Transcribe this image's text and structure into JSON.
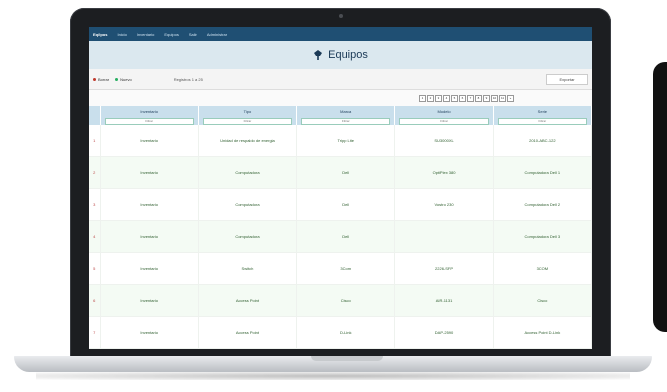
{
  "app": {
    "brand": "Eq/ipos",
    "nav": [
      "Inicio",
      "Inventario",
      "Equipos",
      "Salir",
      "Administrar"
    ]
  },
  "page": {
    "title": "Equipos"
  },
  "actions": {
    "delete_label": "Borrar",
    "new_label": "Nuevo",
    "info": "Registros 1 a 25",
    "export_label": "Exportar"
  },
  "pager": {
    "pages": [
      "1",
      "2",
      "3",
      "4",
      "5",
      "6",
      "7",
      "8",
      "9",
      "10",
      "11",
      "»"
    ]
  },
  "table": {
    "headers": [
      "Inventario",
      "Tipo",
      "Marca",
      "Modelo",
      "Serie"
    ],
    "filter_placeholder": "Filtrar",
    "rows": [
      {
        "n": "1",
        "cells": [
          "Inventario",
          "Unidad de respaldo de energia",
          "Tripp Lite",
          "SU3000XL",
          "2010-ABC-122"
        ]
      },
      {
        "n": "2",
        "cells": [
          "Inventario",
          "Computadora",
          "Dell",
          "OptiPlex 380",
          "Computadora Dell 1"
        ]
      },
      {
        "n": "3",
        "cells": [
          "Inventario",
          "Computadora",
          "Dell",
          "Vostro 230",
          "Computadora Dell 2"
        ]
      },
      {
        "n": "4",
        "cells": [
          "Inventario",
          "Computadora",
          "Dell",
          "",
          "Computadora Dell 3"
        ]
      },
      {
        "n": "5",
        "cells": [
          "Inventario",
          "Switch",
          "3Com",
          "2226-SFP",
          "3COM"
        ]
      },
      {
        "n": "6",
        "cells": [
          "Inventario",
          "Access Point",
          "Cisco",
          "AIR-1131",
          "Cisco"
        ]
      },
      {
        "n": "7",
        "cells": [
          "Inventario",
          "Access Point",
          "D-Link",
          "DAP-2590",
          "Access Point D-Link"
        ]
      }
    ]
  },
  "colors": {
    "nav": "#1f4f73",
    "title_bar": "#dbe8ef",
    "header": "#c9dfec",
    "row_alt": "#f4fbf4"
  }
}
